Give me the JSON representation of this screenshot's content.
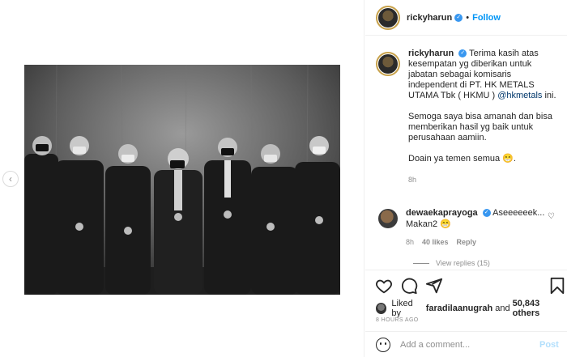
{
  "media": {
    "prev_icon": "chevron-left-icon"
  },
  "header": {
    "username": "rickyharun",
    "verified_icon": "verified-badge-icon",
    "separator": "•",
    "follow_label": "Follow"
  },
  "caption": {
    "username": "rickyharun",
    "text_part1": "Terima kasih atas kesempatan yg diberikan untuk jabatan sebagai komisaris independent di PT. HK METALS UTAMA Tbk ( HKMU ) ",
    "mention": "@hkmetals",
    "text_part1_end": " ini.",
    "paragraph2": "Semoga saya bisa amanah dan bisa memberikan hasil yg baik untuk perusahaan aamiin.",
    "paragraph3": "Doain ya temen semua 😁.",
    "time": "8h"
  },
  "comment": {
    "username": "dewaekaprayoga",
    "text": "Aseeeeeek... Makan2 😁",
    "time": "8h",
    "likes": "40 likes",
    "reply_label": "Reply",
    "view_replies": "View replies (15)"
  },
  "actions": {
    "like_icon": "heart-icon",
    "comment_icon": "comment-icon",
    "share_icon": "share-icon",
    "save_icon": "bookmark-icon"
  },
  "likes": {
    "prefix": "Liked by ",
    "user": "faradilaanugrah",
    "middle": " and ",
    "count": "50,843 others"
  },
  "date": "8 HOURS AGO",
  "add_comment": {
    "placeholder": "Add a comment...",
    "post_label": "Post"
  },
  "colors": {
    "accent": "#0095f6",
    "post_disabled": "#b2dffc",
    "muted": "#8e8e8e",
    "text": "#262626"
  }
}
